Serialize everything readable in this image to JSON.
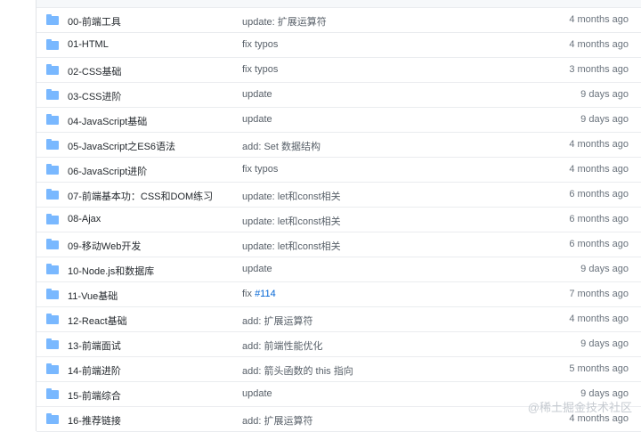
{
  "rows": [
    {
      "name": "00-前端工具",
      "message": "update: 扩展运算符",
      "age": "4 months ago"
    },
    {
      "name": "01-HTML",
      "message": "fix typos",
      "age": "4 months ago"
    },
    {
      "name": "02-CSS基础",
      "message": "fix typos",
      "age": "3 months ago"
    },
    {
      "name": "03-CSS进阶",
      "message": "update",
      "age": "9 days ago"
    },
    {
      "name": "04-JavaScript基础",
      "message": "update",
      "age": "9 days ago"
    },
    {
      "name": "05-JavaScript之ES6语法",
      "message": "add: Set 数据结构",
      "age": "4 months ago"
    },
    {
      "name": "06-JavaScript进阶",
      "message": "fix typos",
      "age": "4 months ago"
    },
    {
      "name": "07-前端基本功：CSS和DOM练习",
      "message": "update: let和const相关",
      "age": "6 months ago"
    },
    {
      "name": "08-Ajax",
      "message": "update: let和const相关",
      "age": "6 months ago"
    },
    {
      "name": "09-移动Web开发",
      "message": "update: let和const相关",
      "age": "6 months ago"
    },
    {
      "name": "10-Node.js和数据库",
      "message": "update",
      "age": "9 days ago"
    },
    {
      "name": "11-Vue基础",
      "message": "fix",
      "issue": "#114",
      "age": "7 months ago"
    },
    {
      "name": "12-React基础",
      "message": "add: 扩展运算符",
      "age": "4 months ago"
    },
    {
      "name": "13-前端面试",
      "message": "add: 前端性能优化",
      "age": "9 days ago"
    },
    {
      "name": "14-前端进阶",
      "message": "add: 箭头函数的 this 指向",
      "age": "5 months ago"
    },
    {
      "name": "15-前端综合",
      "message": "update",
      "age": "9 days ago"
    },
    {
      "name": "16-推荐链接",
      "message": "add: 扩展运算符",
      "age": "4 months ago"
    }
  ],
  "watermark": "@稀土掘金技术社区",
  "icons": {
    "folder": "folder-icon"
  },
  "colors": {
    "folder": "#79b8ff",
    "link": "#0366d6"
  }
}
